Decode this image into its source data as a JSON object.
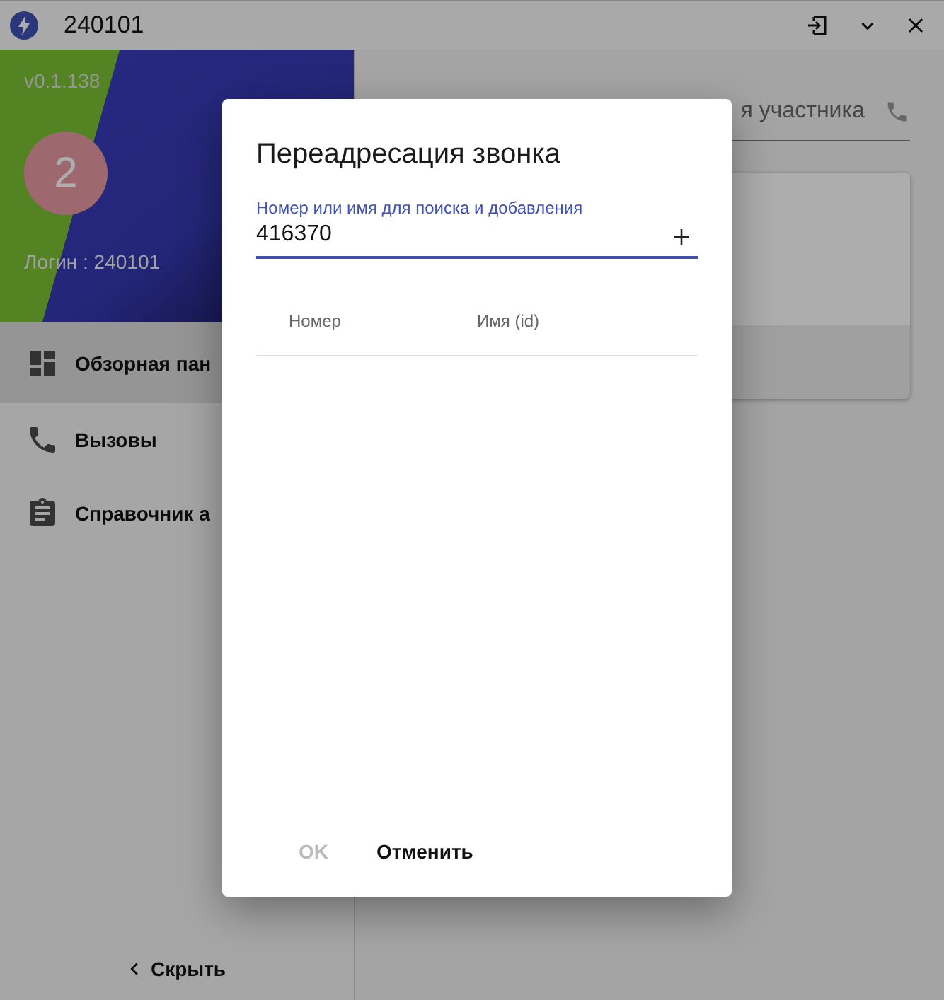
{
  "window": {
    "title": "240101"
  },
  "sidebar": {
    "version": "v0.1.138",
    "avatar": "2",
    "login": "Логин : 240101",
    "items": [
      {
        "label": "Обзорная пан",
        "kind": "dashboard",
        "selected": true
      },
      {
        "label": "Вызовы",
        "kind": "phone",
        "selected": false
      },
      {
        "label": "Справочник а",
        "kind": "clipboard",
        "selected": false
      }
    ],
    "hide": "Скрыть"
  },
  "main": {
    "search_placeholder": "я участника"
  },
  "dialog": {
    "title": "Переадресация звонка",
    "field": {
      "label": "Номер или имя для поиска и добавления",
      "value": "416370"
    },
    "columns": [
      "Номер",
      "Имя (id)"
    ],
    "buttons": [
      {
        "label": "OK",
        "disabled": true
      },
      {
        "label": "Отменить",
        "disabled": false
      }
    ]
  }
}
